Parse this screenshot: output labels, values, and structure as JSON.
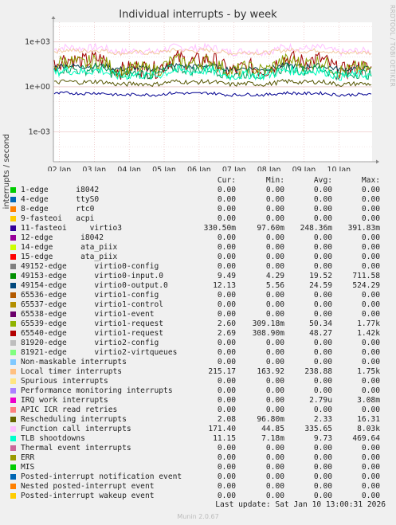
{
  "chart_data": {
    "type": "line",
    "title": "Individual interrupts - by week",
    "ylabel": "interrupts / second",
    "yscale": "log",
    "yticks": [
      "1e+03",
      "1e+00",
      "1e-03"
    ],
    "ylim": [
      1e-05,
      20000
    ],
    "xticks": [
      "02 Jan",
      "03 Jan",
      "04 Jan",
      "05 Jan",
      "06 Jan",
      "07 Jan",
      "08 Jan",
      "09 Jan",
      "10 Jan"
    ],
    "grid": true,
    "series": [
      {
        "name": "Function call interrupts",
        "color": "#ffc0ff",
        "base": 300,
        "noise": 0.5
      },
      {
        "name": "Local timer interrupts",
        "color": "#f2c9a0",
        "base": 220,
        "noise": 0.3
      },
      {
        "name": "virtio1-request",
        "color": "#a00000",
        "base": 30,
        "noise": 1.2
      },
      {
        "name": "virtio0-output.0",
        "color": "#004050",
        "base": 20,
        "noise": 0.35
      },
      {
        "name": "virtio1-request",
        "color": "#8aa000",
        "base": 25,
        "noise": 1.0
      },
      {
        "name": "virtio0-input.0",
        "color": "#00a060",
        "base": 10,
        "noise": 0.7
      },
      {
        "name": "TLB shootdowns",
        "color": "#00ffc0",
        "base": 8,
        "noise": 0.6
      },
      {
        "name": "Rescheduling interrupts",
        "color": "#555500",
        "base": 1.8,
        "noise": 0.3
      },
      {
        "name": "11-fasteoi",
        "color": "#000090",
        "base": 0.33,
        "noise": 0.2
      }
    ]
  },
  "side_label": "RRDTOOL / TOBI OETIKER",
  "legend": {
    "headers": [
      "Cur:",
      "Min:",
      "Avg:",
      "Max:"
    ],
    "rows": [
      {
        "name": "1-edge      i8042",
        "color": "#00cc00",
        "cur": "0.00",
        "min": "0.00",
        "avg": "0.00",
        "max": "0.00"
      },
      {
        "name": "4-edge      ttyS0",
        "color": "#0066b3",
        "cur": "0.00",
        "min": "0.00",
        "avg": "0.00",
        "max": "0.00"
      },
      {
        "name": "8-edge      rtc0",
        "color": "#ff8000",
        "cur": "0.00",
        "min": "0.00",
        "avg": "0.00",
        "max": "0.00"
      },
      {
        "name": "9-fasteoi   acpi",
        "color": "#ffcc00",
        "cur": "0.00",
        "min": "0.00",
        "avg": "0.00",
        "max": "0.00"
      },
      {
        "name": "11-fasteoi     virtio3",
        "color": "#330099",
        "cur": "330.50m",
        "min": "97.60m",
        "avg": "248.36m",
        "max": "391.83m"
      },
      {
        "name": "12-edge      i8042",
        "color": "#990099",
        "cur": "0.00",
        "min": "0.00",
        "avg": "0.00",
        "max": "0.00"
      },
      {
        "name": "14-edge      ata_piix",
        "color": "#ccff00",
        "cur": "0.00",
        "min": "0.00",
        "avg": "0.00",
        "max": "0.00"
      },
      {
        "name": "15-edge      ata_piix",
        "color": "#ff0000",
        "cur": "0.00",
        "min": "0.00",
        "avg": "0.00",
        "max": "0.00"
      },
      {
        "name": "49152-edge      virtio0-config",
        "color": "#808080",
        "cur": "0.00",
        "min": "0.00",
        "avg": "0.00",
        "max": "0.00"
      },
      {
        "name": "49153-edge      virtio0-input.0",
        "color": "#008f00",
        "cur": "9.49",
        "min": "4.29",
        "avg": "19.52",
        "max": "711.58"
      },
      {
        "name": "49154-edge      virtio0-output.0",
        "color": "#00487d",
        "cur": "12.13",
        "min": "5.56",
        "avg": "24.59",
        "max": "524.29"
      },
      {
        "name": "65536-edge      virtio1-config",
        "color": "#b35a00",
        "cur": "0.00",
        "min": "0.00",
        "avg": "0.00",
        "max": "0.00"
      },
      {
        "name": "65537-edge      virtio1-control",
        "color": "#b38f00",
        "cur": "0.00",
        "min": "0.00",
        "avg": "0.00",
        "max": "0.00"
      },
      {
        "name": "65538-edge      virtio1-event",
        "color": "#6b006b",
        "cur": "0.00",
        "min": "0.00",
        "avg": "0.00",
        "max": "0.00"
      },
      {
        "name": "65539-edge      virtio1-request",
        "color": "#8fb300",
        "cur": "2.60",
        "min": "309.18m",
        "avg": "50.34",
        "max": "1.77k"
      },
      {
        "name": "65540-edge      virtio1-request",
        "color": "#b30000",
        "cur": "2.69",
        "min": "308.90m",
        "avg": "48.27",
        "max": "1.42k"
      },
      {
        "name": "81920-edge      virtio2-config",
        "color": "#bebebe",
        "cur": "0.00",
        "min": "0.00",
        "avg": "0.00",
        "max": "0.00"
      },
      {
        "name": "81921-edge      virtio2-virtqueues",
        "color": "#80ff80",
        "cur": "0.00",
        "min": "0.00",
        "avg": "0.00",
        "max": "0.00"
      },
      {
        "name": "Non-maskable interrupts",
        "color": "#80c9ff",
        "cur": "0.00",
        "min": "0.00",
        "avg": "0.00",
        "max": "0.00"
      },
      {
        "name": "Local timer interrupts",
        "color": "#ffc080",
        "cur": "215.17",
        "min": "163.92",
        "avg": "238.88",
        "max": "1.75k"
      },
      {
        "name": "Spurious interrupts",
        "color": "#ffe680",
        "cur": "0.00",
        "min": "0.00",
        "avg": "0.00",
        "max": "0.00"
      },
      {
        "name": "Performance monitoring interrupts",
        "color": "#aa80ff",
        "cur": "0.00",
        "min": "0.00",
        "avg": "0.00",
        "max": "0.00"
      },
      {
        "name": "IRQ work interrupts",
        "color": "#ee00cc",
        "cur": "0.00",
        "min": "0.00",
        "avg": "2.79u",
        "max": "3.08m"
      },
      {
        "name": "APIC ICR read retries",
        "color": "#ff8080",
        "cur": "0.00",
        "min": "0.00",
        "avg": "0.00",
        "max": "0.00"
      },
      {
        "name": "Rescheduling interrupts",
        "color": "#666600",
        "cur": "2.08",
        "min": "96.80m",
        "avg": "2.33",
        "max": "16.31"
      },
      {
        "name": "Function call interrupts",
        "color": "#ffbfff",
        "cur": "171.40",
        "min": "44.85",
        "avg": "335.65",
        "max": "8.03k"
      },
      {
        "name": "TLB shootdowns",
        "color": "#00ffcc",
        "cur": "11.15",
        "min": "7.18m",
        "avg": "9.73",
        "max": "469.64"
      },
      {
        "name": "Thermal event interrupts",
        "color": "#cc6699",
        "cur": "0.00",
        "min": "0.00",
        "avg": "0.00",
        "max": "0.00"
      },
      {
        "name": "ERR",
        "color": "#999900",
        "cur": "0.00",
        "min": "0.00",
        "avg": "0.00",
        "max": "0.00"
      },
      {
        "name": "MIS",
        "color": "#00cc00",
        "cur": "0.00",
        "min": "0.00",
        "avg": "0.00",
        "max": "0.00"
      },
      {
        "name": "Posted-interrupt notification event",
        "color": "#0066b3",
        "cur": "0.00",
        "min": "0.00",
        "avg": "0.00",
        "max": "0.00"
      },
      {
        "name": "Nested posted-interrupt event",
        "color": "#ff8000",
        "cur": "0.00",
        "min": "0.00",
        "avg": "0.00",
        "max": "0.00"
      },
      {
        "name": "Posted-interrupt wakeup event",
        "color": "#ffcc00",
        "cur": "0.00",
        "min": "0.00",
        "avg": "0.00",
        "max": "0.00"
      }
    ]
  },
  "footer": "Last update: Sat Jan 10 13:00:31 2026",
  "munin": "Munin 2.0.67"
}
